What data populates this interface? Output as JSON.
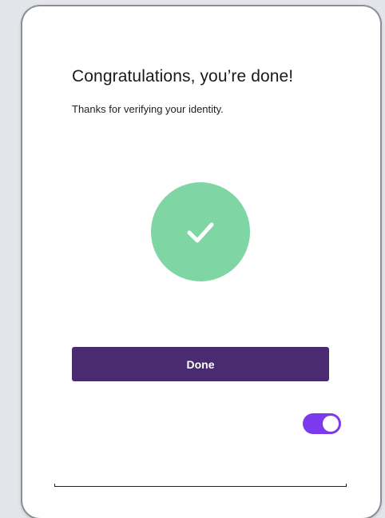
{
  "dialog": {
    "title": "Congratulations, you’re done!",
    "subtitle": "Thanks for verifying your identity.",
    "status_icon": "check-icon",
    "done_label": "Done",
    "toggle_on": true
  },
  "colors": {
    "success": "#7fd5a3",
    "primary_button": "#4a2b72",
    "toggle_active": "#7c3aed",
    "card_background": "#ffffff",
    "page_background": "#e3e5ea"
  }
}
